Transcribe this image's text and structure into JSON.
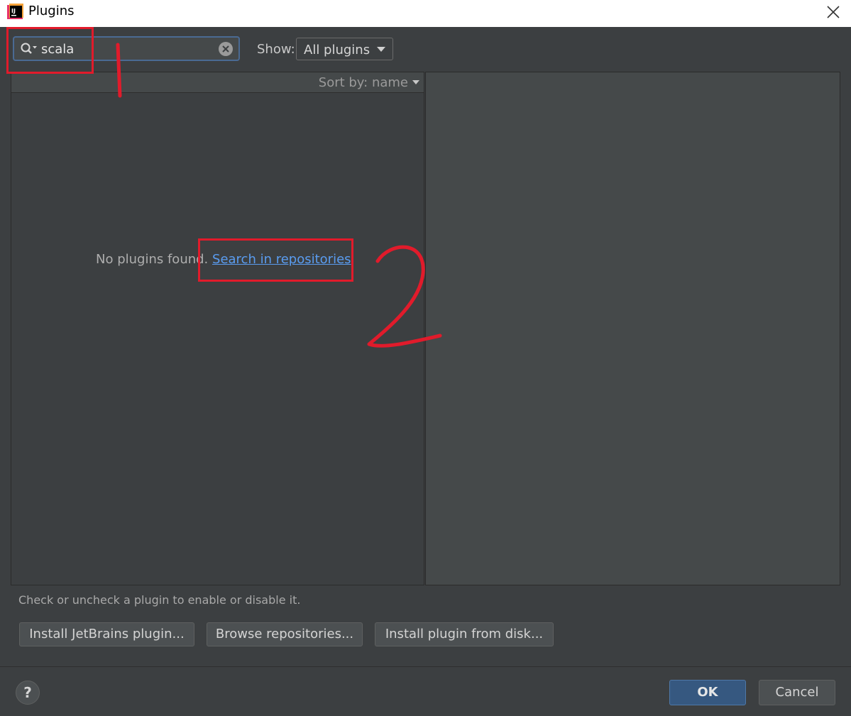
{
  "window": {
    "title": "Plugins"
  },
  "search": {
    "value": "scala",
    "placeholder": ""
  },
  "toolbar": {
    "show_label": "Show:",
    "show_value": "All plugins"
  },
  "list": {
    "sort_label": "Sort by: name",
    "empty_text": "No plugins found. ",
    "search_link": "Search in repositories"
  },
  "footer": {
    "hint": "Check or uncheck a plugin to enable or disable it.",
    "buttons": [
      "Install JetBrains plugin...",
      "Browse repositories...",
      "Install plugin from disk..."
    ],
    "help_label": "?",
    "ok_label": "OK",
    "cancel_label": "Cancel"
  },
  "annotations": {
    "marker_1": "1",
    "marker_2": "2",
    "color": "#e11b2b"
  },
  "colors": {
    "link": "#5a9cf0",
    "primary_button": "#365880",
    "background": "#3c3f41"
  }
}
